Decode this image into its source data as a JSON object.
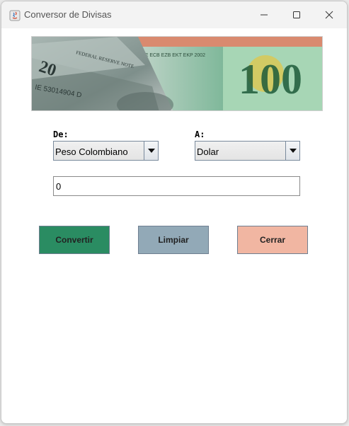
{
  "window": {
    "title": "Conversor de Divisas",
    "controls": [
      "minimize-icon",
      "maximize-icon",
      "close-icon"
    ]
  },
  "banner": {
    "image": "banknotes-dollar-euro",
    "euro_denomination": "100",
    "dollar_denomination": "20",
    "serial": "IE 53014904 D",
    "euro_text": "BCE ECB EZB EKT EKP 2002",
    "dollar_text": "FEDERAL RESERVE NOTE"
  },
  "form": {
    "from_label": "De:",
    "to_label": "A:",
    "from_currency": "Peso Colombiano",
    "to_currency": "Dolar",
    "amount_value": "0"
  },
  "buttons": {
    "convert_label": "Convertir",
    "clear_label": "Limpiar",
    "close_label": "Cerrar"
  },
  "colors": {
    "convert": "#2a8c62",
    "clear": "#92a9b7",
    "close": "#f1b6a2"
  }
}
